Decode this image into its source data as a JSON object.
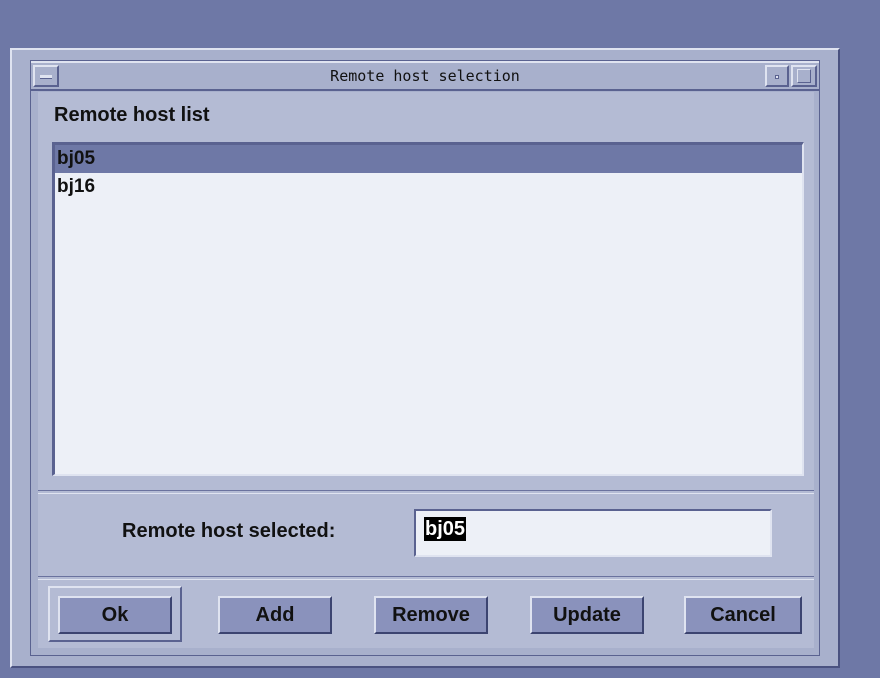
{
  "window": {
    "title": "Remote host selection"
  },
  "host_list": {
    "label": "Remote host list",
    "items": [
      {
        "name": "bj05",
        "selected": true
      },
      {
        "name": "bj16",
        "selected": false
      }
    ]
  },
  "selection": {
    "label": "Remote host selected:",
    "value": "bj05"
  },
  "buttons": {
    "ok": "Ok",
    "add": "Add",
    "remove": "Remove",
    "update": "Update",
    "cancel": "Cancel"
  },
  "colors": {
    "background": "#6e78a6",
    "dialog": "#a8b0cc",
    "selection_highlight": "#6e78a6",
    "list_background": "#edf0f7"
  }
}
